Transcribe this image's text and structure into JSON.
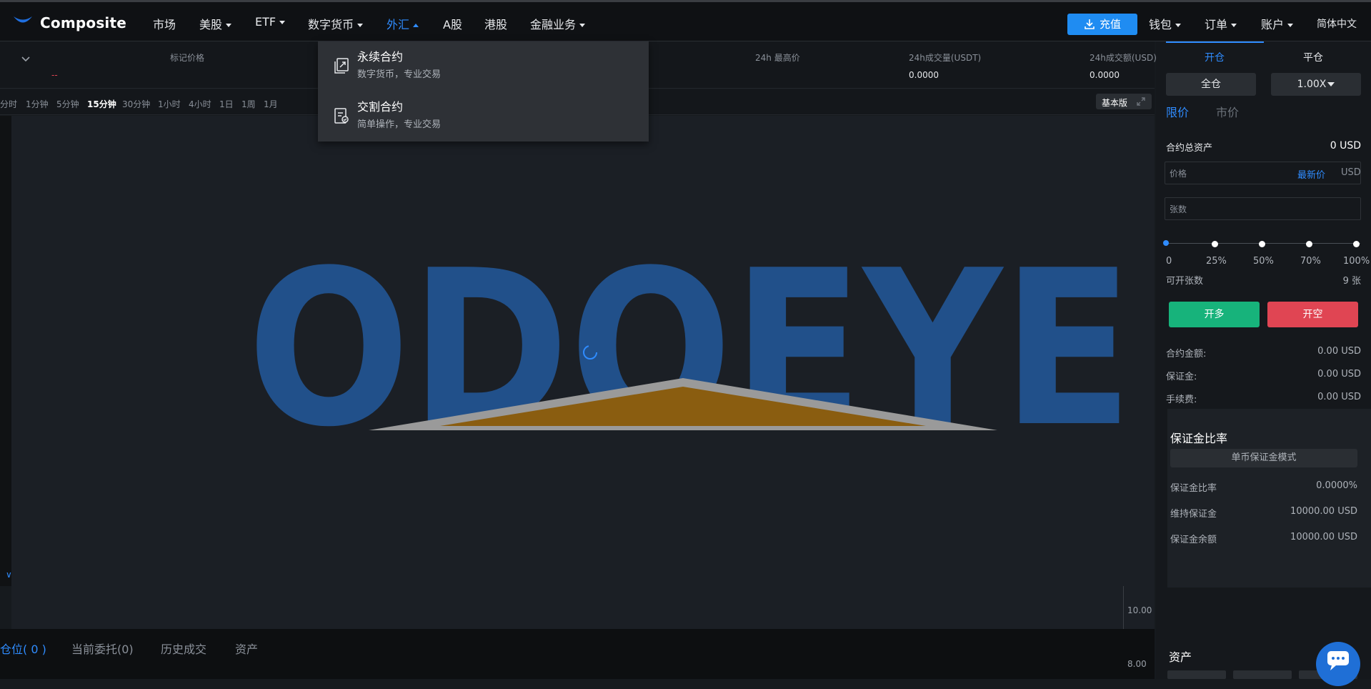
{
  "header": {
    "brand": "Composite",
    "nav": [
      "市场",
      "美股",
      "ETF",
      "数字货币",
      "外汇",
      "A股",
      "港股",
      "金融业务"
    ],
    "deposit_label": "充值",
    "wallet": "钱包",
    "orders": "订单",
    "account": "账户",
    "language": "简体中文",
    "accent_color": "#2f8cff"
  },
  "ticker": {
    "mark_price_label": "标记价格",
    "mark_price_value": "--",
    "high_label": "24h 最高价",
    "vol_label": "24h成交量(USDT)",
    "vol_value": "0.0000",
    "amount_label": "24h成交额(USD)",
    "amount_value": "0.0000"
  },
  "timeframes": [
    "分时",
    "1分钟",
    "5分钟",
    "15分钟",
    "30分钟",
    "1小时",
    "4小时",
    "1日",
    "1周",
    "1月"
  ],
  "selected_timeframe": "15分钟",
  "basic_label": "基本版",
  "chart_overlay": "ODOEYE",
  "scale": [
    "10.00",
    "8.00"
  ],
  "dropdown": {
    "items": [
      {
        "title": "永续合约",
        "subtitle": "数字货币，专业交易"
      },
      {
        "title": "交割合约",
        "subtitle": "简单操作，专业交易"
      }
    ]
  },
  "bottom_tabs": [
    "仓位( 0 )",
    "当前委托(0)",
    "历史成交",
    "资产"
  ],
  "panel": {
    "open_tab": "开仓",
    "close_tab": "平仓",
    "cross_label": "全仓",
    "leverage_label": "1.00X",
    "limit_tab": "限价",
    "market_tab": "市价",
    "total_assets_label": "合约总资产",
    "total_assets_value": "0 USD",
    "price_placeholder": "价格",
    "latest_price_label": "最新价",
    "currency": "USD",
    "qty_placeholder": "张数",
    "percents": [
      "0",
      "25%",
      "50%",
      "70%",
      "100%"
    ],
    "available_label": "可开张数",
    "available_value": "9 张",
    "long_label": "开多",
    "short_label": "开空",
    "contract_amount_label": "合约金额:",
    "contract_amount_value": "0.00 USD",
    "margin_label": "保证金:",
    "margin_value": "0.00 USD",
    "fee_label": "手续费:",
    "fee_value": "0.00 USD",
    "margin_ratio_title": "保证金比率",
    "single_margin_mode": "单币保证金模式",
    "ratio_label": "保证金比率",
    "ratio_value": "0.0000%",
    "maint_label": "维持保证金",
    "maint_value": "10000.00 USD",
    "balance_label": "保证金余额",
    "balance_value": "10000.00 USD",
    "assets_title": "资产",
    "long_color": "#17b37b",
    "short_color": "#e04553"
  }
}
